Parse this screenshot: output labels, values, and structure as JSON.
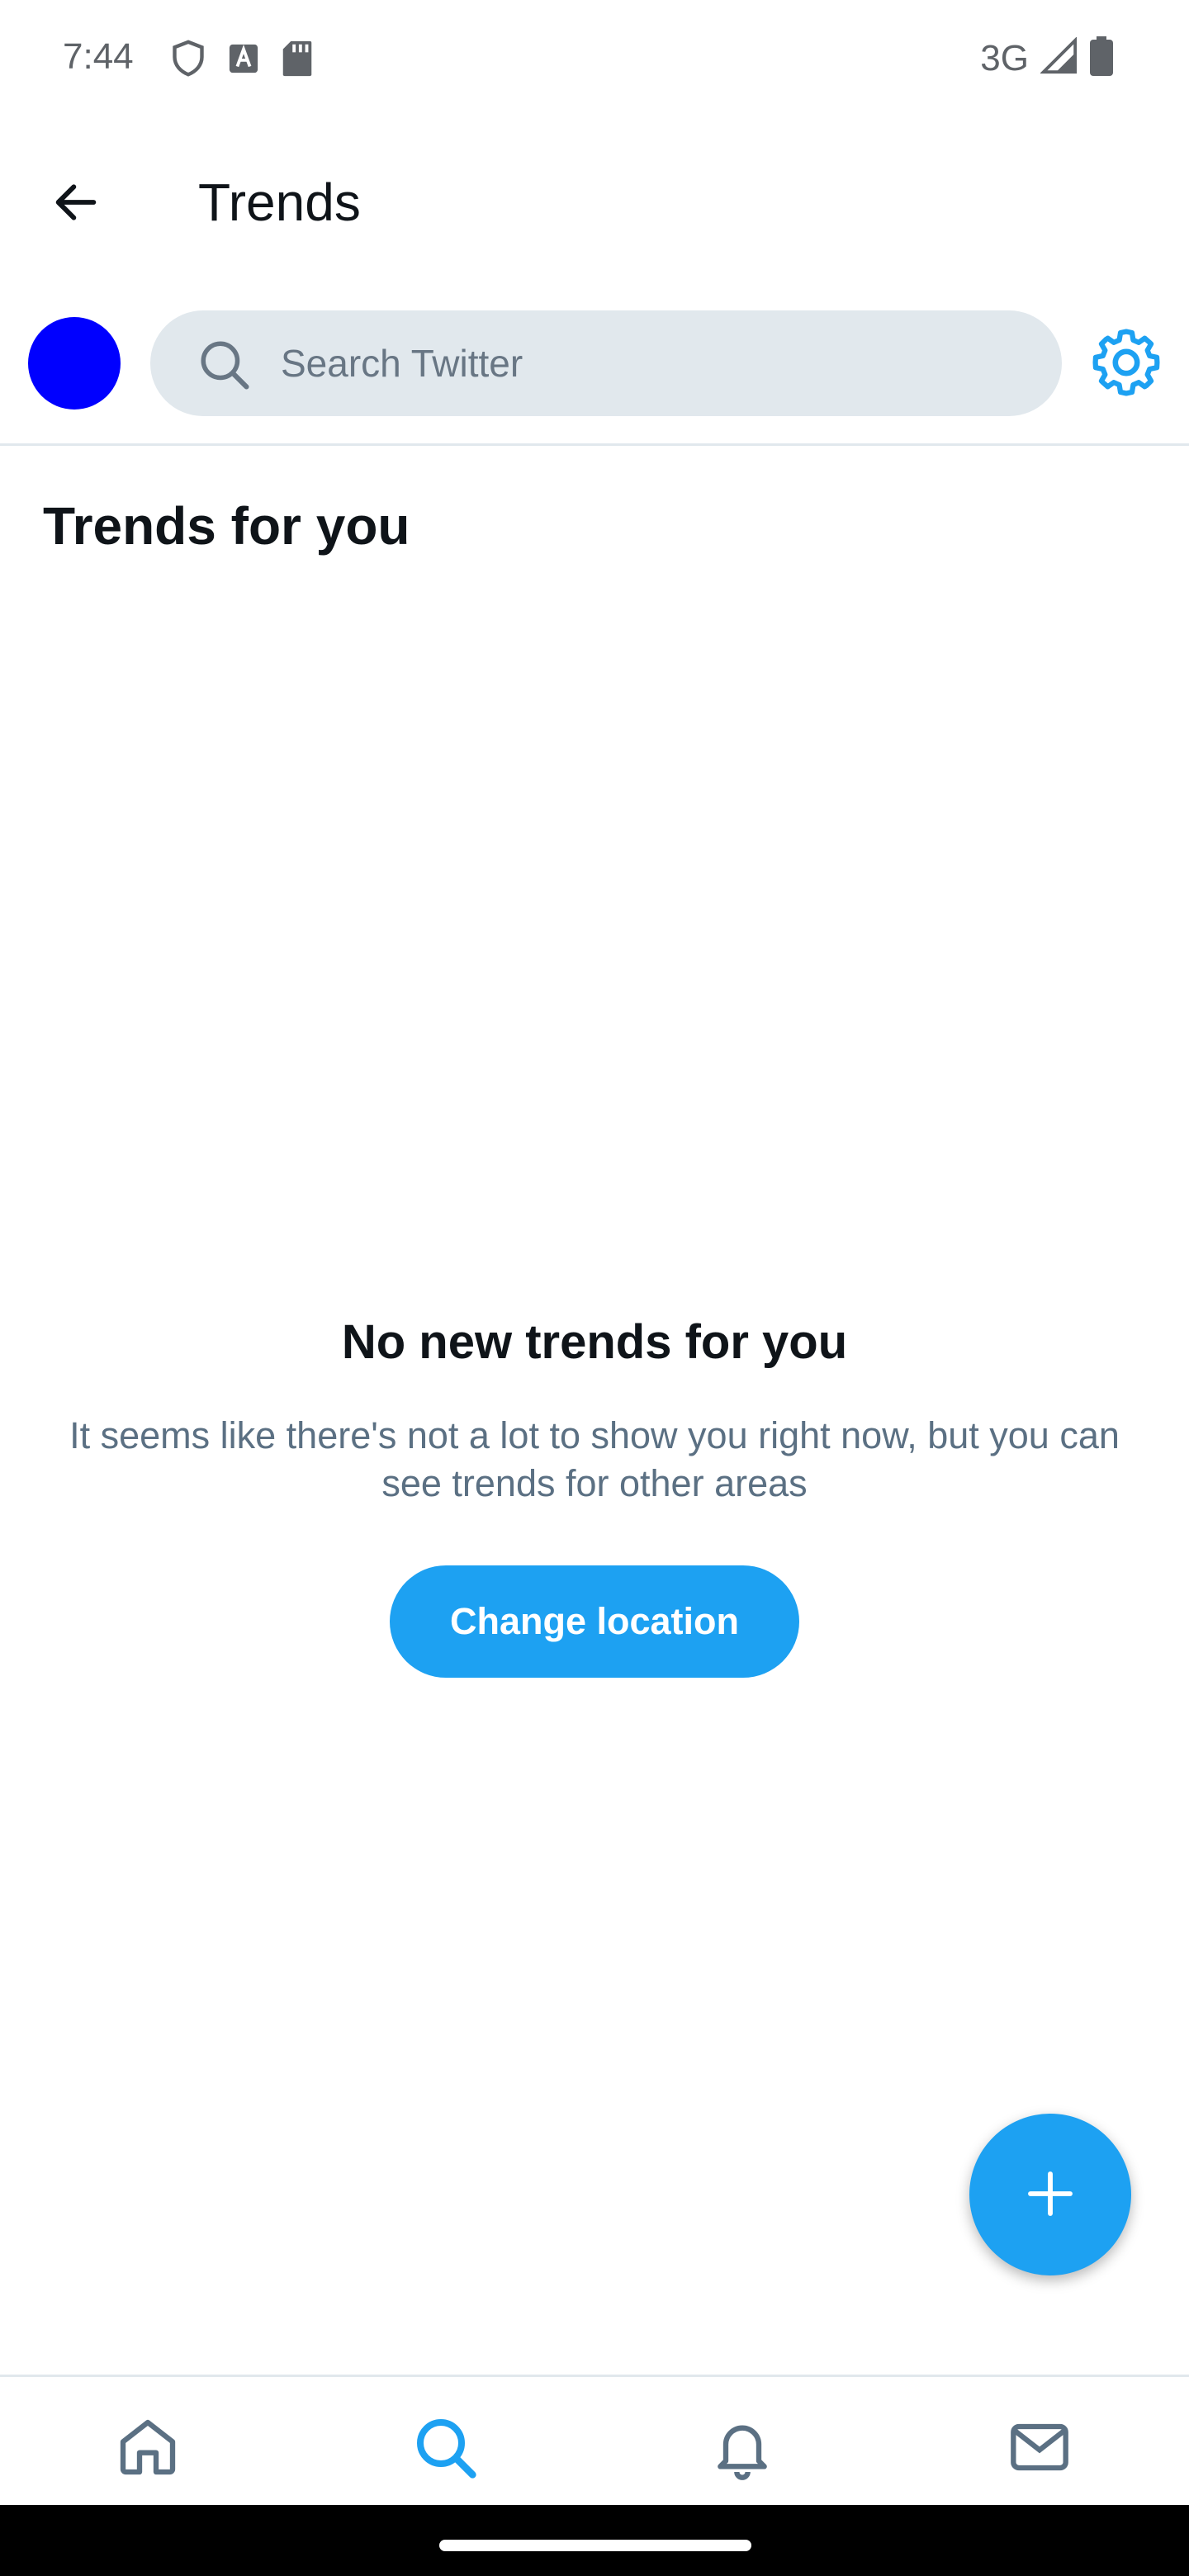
{
  "status_bar": {
    "time": "7:44",
    "network": "3G",
    "icons": [
      "shield-icon",
      "keyboard-a-icon",
      "sd-card-icon",
      "signal-icon",
      "battery-icon"
    ]
  },
  "header": {
    "title": "Trends",
    "back_icon": "arrow-left-icon"
  },
  "search": {
    "placeholder": "Search Twitter",
    "value": ""
  },
  "section": {
    "title": "Trends for you"
  },
  "empty_state": {
    "title": "No new trends for you",
    "description": "It seems like there's not a lot to show you right now, but you can see trends for other areas",
    "button_label": "Change location"
  },
  "fab": {
    "icon": "plus-icon"
  },
  "bottom_nav": {
    "items": [
      {
        "id": "home",
        "icon": "home-icon",
        "active": false
      },
      {
        "id": "search",
        "icon": "search-icon",
        "active": true
      },
      {
        "id": "notifications",
        "icon": "bell-icon",
        "active": false
      },
      {
        "id": "messages",
        "icon": "mail-icon",
        "active": false
      }
    ]
  },
  "colors": {
    "accent": "#1da1f2",
    "avatar": "#0000ff",
    "search_bg": "#e1e8ed",
    "secondary_text": "#5b7083",
    "primary_text": "#0f1419"
  }
}
